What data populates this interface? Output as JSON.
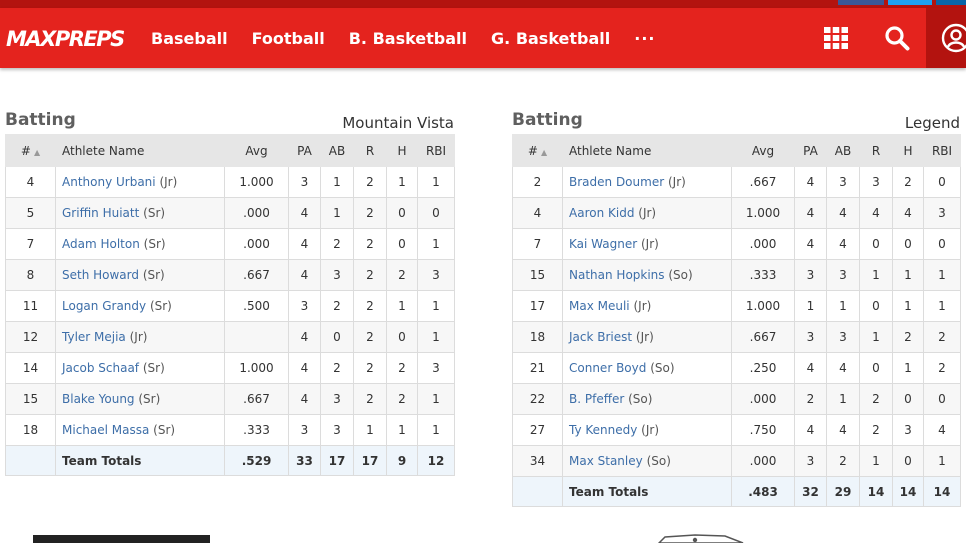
{
  "nav": {
    "logo_text": "MAXPREPS",
    "items": [
      "Baseball",
      "Football",
      "B. Basketball",
      "G. Basketball",
      "···"
    ]
  },
  "colors": {
    "brand_red": "#e4231e",
    "dark_red": "#b3130f",
    "link_blue": "#3d6ea8"
  },
  "icons": {
    "grid": "grid-icon",
    "search": "search-icon",
    "user": "user-icon"
  },
  "columns": {
    "num": "#",
    "name": "Athlete Name",
    "avg": "Avg",
    "pa": "PA",
    "ab": "AB",
    "r": "R",
    "h": "H",
    "rbi": "RBI"
  },
  "tables": [
    {
      "title": "Batting",
      "team": "Mountain Vista",
      "rows": [
        {
          "num": "4",
          "name": "Anthony Urbani",
          "cls": "(Jr)",
          "avg": "1.000",
          "pa": "3",
          "ab": "1",
          "r": "2",
          "h": "1",
          "rbi": "1"
        },
        {
          "num": "5",
          "name": "Griffin Huiatt",
          "cls": "(Sr)",
          "avg": ".000",
          "pa": "4",
          "ab": "1",
          "r": "2",
          "h": "0",
          "rbi": "0"
        },
        {
          "num": "7",
          "name": "Adam Holton",
          "cls": "(Sr)",
          "avg": ".000",
          "pa": "4",
          "ab": "2",
          "r": "2",
          "h": "0",
          "rbi": "1"
        },
        {
          "num": "8",
          "name": "Seth Howard",
          "cls": "(Sr)",
          "avg": ".667",
          "pa": "4",
          "ab": "3",
          "r": "2",
          "h": "2",
          "rbi": "3"
        },
        {
          "num": "11",
          "name": "Logan Grandy",
          "cls": "(Sr)",
          "avg": ".500",
          "pa": "3",
          "ab": "2",
          "r": "2",
          "h": "1",
          "rbi": "1"
        },
        {
          "num": "12",
          "name": "Tyler Mejia",
          "cls": "(Jr)",
          "avg": "",
          "pa": "4",
          "ab": "0",
          "r": "2",
          "h": "0",
          "rbi": "1"
        },
        {
          "num": "14",
          "name": "Jacob Schaaf",
          "cls": "(Sr)",
          "avg": "1.000",
          "pa": "4",
          "ab": "2",
          "r": "2",
          "h": "2",
          "rbi": "3"
        },
        {
          "num": "15",
          "name": "Blake Young",
          "cls": "(Sr)",
          "avg": ".667",
          "pa": "4",
          "ab": "3",
          "r": "2",
          "h": "2",
          "rbi": "1"
        },
        {
          "num": "18",
          "name": "Michael Massa",
          "cls": "(Sr)",
          "avg": ".333",
          "pa": "3",
          "ab": "3",
          "r": "1",
          "h": "1",
          "rbi": "1"
        }
      ],
      "totals": {
        "label": "Team Totals",
        "avg": ".529",
        "pa": "33",
        "ab": "17",
        "r": "17",
        "h": "9",
        "rbi": "12"
      }
    },
    {
      "title": "Batting",
      "team": "Legend",
      "rows": [
        {
          "num": "2",
          "name": "Braden Doumer",
          "cls": "(Jr)",
          "avg": ".667",
          "pa": "4",
          "ab": "3",
          "r": "3",
          "h": "2",
          "rbi": "0"
        },
        {
          "num": "4",
          "name": "Aaron Kidd",
          "cls": "(Jr)",
          "avg": "1.000",
          "pa": "4",
          "ab": "4",
          "r": "4",
          "h": "4",
          "rbi": "3"
        },
        {
          "num": "7",
          "name": "Kai Wagner",
          "cls": "(Jr)",
          "avg": ".000",
          "pa": "4",
          "ab": "4",
          "r": "0",
          "h": "0",
          "rbi": "0"
        },
        {
          "num": "15",
          "name": "Nathan Hopkins",
          "cls": "(So)",
          "avg": ".333",
          "pa": "3",
          "ab": "3",
          "r": "1",
          "h": "1",
          "rbi": "1"
        },
        {
          "num": "17",
          "name": "Max Meuli",
          "cls": "(Jr)",
          "avg": "1.000",
          "pa": "1",
          "ab": "1",
          "r": "0",
          "h": "1",
          "rbi": "1"
        },
        {
          "num": "18",
          "name": "Jack Briest",
          "cls": "(Jr)",
          "avg": ".667",
          "pa": "3",
          "ab": "3",
          "r": "1",
          "h": "2",
          "rbi": "2"
        },
        {
          "num": "21",
          "name": "Conner Boyd",
          "cls": "(So)",
          "avg": ".250",
          "pa": "4",
          "ab": "4",
          "r": "0",
          "h": "1",
          "rbi": "2"
        },
        {
          "num": "22",
          "name": "B. Pfeffer",
          "cls": "(So)",
          "avg": ".000",
          "pa": "2",
          "ab": "1",
          "r": "2",
          "h": "0",
          "rbi": "0"
        },
        {
          "num": "27",
          "name": "Ty Kennedy",
          "cls": "(Jr)",
          "avg": ".750",
          "pa": "4",
          "ab": "4",
          "r": "2",
          "h": "3",
          "rbi": "4"
        },
        {
          "num": "34",
          "name": "Max Stanley",
          "cls": "(So)",
          "avg": ".000",
          "pa": "3",
          "ab": "2",
          "r": "1",
          "h": "0",
          "rbi": "1"
        }
      ],
      "totals": {
        "label": "Team Totals",
        "avg": ".483",
        "pa": "32",
        "ab": "29",
        "r": "14",
        "h": "14",
        "rbi": "14"
      }
    }
  ]
}
